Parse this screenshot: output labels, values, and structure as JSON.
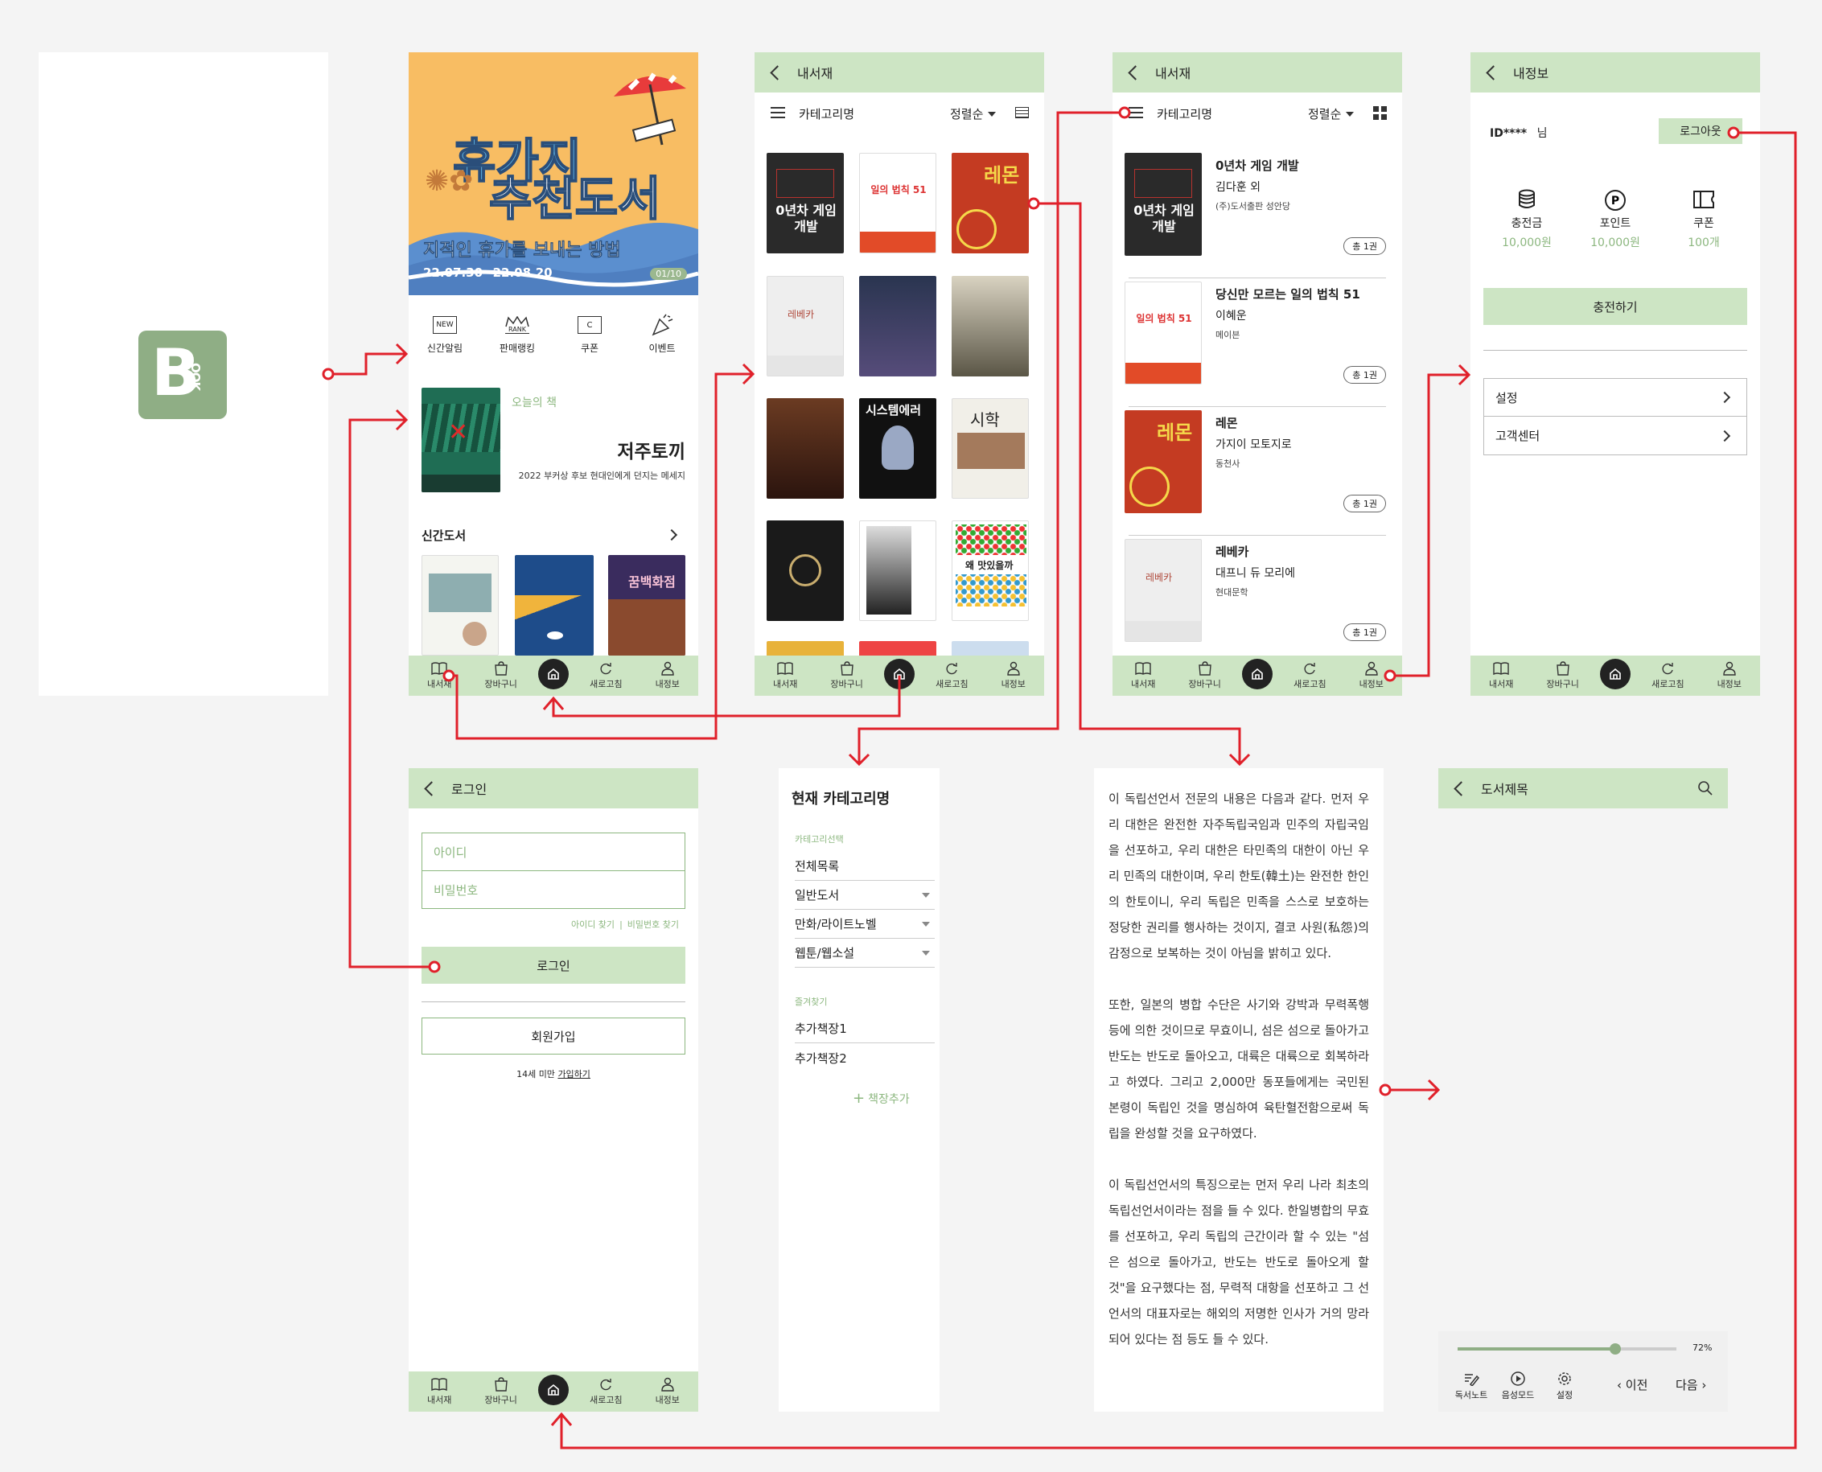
{
  "splash": {
    "logo_letter": "B",
    "logo_side": "OOK"
  },
  "tabbar": {
    "items": [
      "내서재",
      "장바구니",
      "새로고침",
      "내정보"
    ]
  },
  "home": {
    "banner": {
      "title1": "휴가지",
      "title2": "추천도서",
      "subtitle": "지적인 휴가를 보내는 방법",
      "date": "22.07.30~22.08.20",
      "counter": "01/10"
    },
    "menu": [
      {
        "icon_text": "NEW",
        "label": "신간알림"
      },
      {
        "icon_text": "RANK",
        "label": "판매랭킹"
      },
      {
        "icon_text": "C",
        "label": "쿠폰"
      },
      {
        "icon_text": "",
        "label": "이벤트"
      }
    ],
    "today": {
      "label": "오늘의 책",
      "title": "저주토끼",
      "desc": "2022 부커상 후보 현대인에게 던지는 메세지"
    },
    "new_books": {
      "title": "신간도서"
    }
  },
  "library_grid": {
    "header": "내서재",
    "category": "카테고리명",
    "sort": "정렬순",
    "covers": [
      "0년차 게임 개발",
      "일의 법칙 51",
      "레몬",
      "레베카",
      "",
      "",
      "",
      "시스템에러",
      "시학",
      "",
      "",
      "왜 맛있을까"
    ]
  },
  "library_list": {
    "header": "내서재",
    "category": "카테고리명",
    "sort": "정렬순",
    "items": [
      {
        "title": "0년차 게임 개발",
        "author": "김다훈 외",
        "publisher": "(주)도서출판 성안당",
        "count": "총 1권"
      },
      {
        "title": "당신만 모르는 일의 법칙 51",
        "author": "이혜운",
        "publisher": "메이븐",
        "count": "총 1권"
      },
      {
        "title": "레몬",
        "author": "가지이 모토지로",
        "publisher": "동천사",
        "count": "총 1권"
      },
      {
        "title": "레베카",
        "author": "대프니 듀 모리에",
        "publisher": "현대문학",
        "count": "총 1권"
      }
    ]
  },
  "my_info": {
    "header": "내정보",
    "user": "ID****",
    "suffix": "님",
    "logout": "로그아웃",
    "stats": [
      {
        "label": "충전금",
        "value": "10,000원"
      },
      {
        "label": "포인트",
        "value": "10,000원"
      },
      {
        "label": "쿠폰",
        "value": "100개"
      }
    ],
    "charge_button": "충전하기",
    "menu": [
      "설정",
      "고객센터"
    ]
  },
  "login": {
    "header": "로그인",
    "id_placeholder": "아이디",
    "pw_placeholder": "비밀번호",
    "find_id": "아이디 찾기",
    "find_pw": "비밀번호 찾기",
    "login_button": "로그인",
    "signup_button": "회원가입",
    "under14": "14세 미만",
    "under14_link": "가입하기"
  },
  "category_panel": {
    "title": "현재 카테고리명",
    "section1": "카테고리선택",
    "items": [
      "전체목록",
      "일반도서",
      "만화/라이트노벨",
      "웹툰/웹소설"
    ],
    "section2": "즐겨찾기",
    "favorites": [
      "추가책장1",
      "추가책장2"
    ],
    "add_shelf": "책장추가"
  },
  "reader": {
    "paragraphs": [
      "이 독립선언서 전문의 내용은 다음과 같다. 먼저 우리 대한은 완전한 자주독립국임과 민주의 자립국임을 선포하고, 우리 대한은 타민족의 대한이 아닌 우리 민족의 대한이며, 우리 한토(韓土)는 완전한 한인의 한토이니, 우리 독립은 민족을 스스로 보호하는 정당한 권리를 행사하는 것이지, 결코 사원(私怨)의 감정으로 보복하는 것이 아님을 밝히고 있다.",
      "또한, 일본의 병합 수단은 사기와 강박과 무력폭행 등에 의한 것이므로 무효이니, 섬은 섬으로 돌아가고 반도는 반도로 돌아오고, 대륙은 대륙으로 회복하라고 하였다. 그리고 2,000만 동포들에게는 국민된 본령이 독립인 것을 명심하여 육탄혈전함으로써 독립을 완성할 것을 요구하였다.",
      "이 독립선언서의 특징으로는 먼저 우리 나라 최초의 독립선언서이라는 점을 들 수 있다. 한일병합의 무효를 선포하고, 우리 독립의 근간이라 할 수 있는 \"섬은 섬으로 돌아가고, 반도는 반도로 돌아오게 할 것\"을 요구했다는 점, 무력적 대항을 선포하고 그 선언서의 대표자로는 해외의 저명한 인사가 거의 망라되어 있다는 점 등도 들 수 있다."
    ]
  },
  "viewer": {
    "header": "도서제목",
    "progress_label": "72%",
    "progress": 0.72,
    "tools": [
      "독서노트",
      "음성모드",
      "설정"
    ],
    "prev": "이전",
    "next": "다음"
  },
  "colors": {
    "accent": "#cde5c4",
    "arrow": "#e0202a",
    "logo": "#8fae85",
    "green_text": "#8cb77f"
  }
}
